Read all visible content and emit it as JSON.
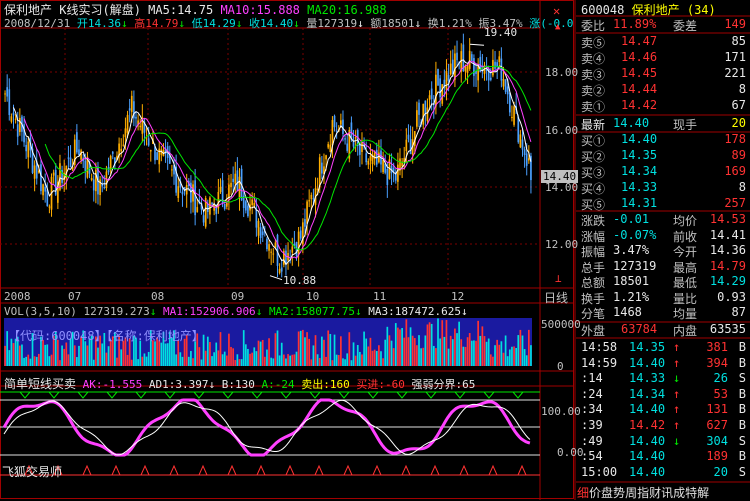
{
  "chart": {
    "title": "保利地产",
    "mode": "K线实习(解盘)",
    "ma5": "MA5:14.75",
    "ma10": "MA10:15.888",
    "ma20": "MA20:16.988",
    "info_line": {
      "date": "2008/12/31",
      "open": "开14.36",
      "high": "高14.79",
      "low": "低14.29",
      "close": "收14.40",
      "volume": "量127319",
      "amount": "额18501",
      "turnover": "换1.21%",
      "amplitude": "振3.47%",
      "change": "涨(-0.0"
    },
    "price_axis": [
      "18.00",
      "16.00",
      "14.00",
      "12.00"
    ],
    "high_label": "19.40",
    "low_label": "10.88",
    "last_price": "14.40",
    "x_months": [
      "2008",
      "07",
      "08",
      "09",
      "10",
      "11",
      "12"
    ],
    "period": "日线",
    "vol_line": {
      "title": "VOL(3,5,10)",
      "value": "127319.273",
      "ma1": "MA1:152906.906",
      "ma2": "MA2:158077.75",
      "ma3": "MA3:187472.625"
    },
    "vol_overlay": "【代码:600048】【名称:保利地产】",
    "vol_axis": [
      "500000",
      "0"
    ],
    "ind_line": {
      "title": "简单短线买卖",
      "ak": "AK:-1.555",
      "ad1": "AD1:3.397",
      "b": "B:130",
      "a": "A:-24",
      "sell": "卖出:160",
      "buy": "买进:-60",
      "strong": "强弱分界:65"
    },
    "ind_axis": [
      "100.00",
      "0.00"
    ],
    "watermark": "飞狐交易师"
  },
  "chart_data": {
    "type": "candlestick",
    "x": [
      "2008",
      "07",
      "08",
      "09",
      "10",
      "11",
      "12"
    ],
    "ylim": [
      10.5,
      20.0
    ],
    "y_ticks": [
      12.0,
      14.0,
      16.0,
      18.0
    ],
    "high": 19.4,
    "low": 10.88,
    "last": 14.4,
    "series": [
      {
        "name": "MA5",
        "last": 14.75
      },
      {
        "name": "MA10",
        "last": 15.888
      },
      {
        "name": "MA20",
        "last": 16.988
      }
    ],
    "volume": {
      "ylim": [
        0,
        500000
      ],
      "last": 127319.273,
      "MA1": 152906.906,
      "MA2": 158077.75,
      "MA3": 187472.625
    },
    "indicator": {
      "ylim": [
        0,
        100
      ],
      "AK": -1.555,
      "AD1": 3.397,
      "B": 130,
      "A": -24
    }
  },
  "quote": {
    "code": "600048",
    "name": "保利地产",
    "count": "(34)",
    "weibi_label": "委比",
    "weibi_value": "11.89%",
    "weicha_label": "委差",
    "weicha_value": "149",
    "sells": [
      {
        "label": "卖⑤",
        "price": "14.47",
        "vol": "85"
      },
      {
        "label": "卖④",
        "price": "14.46",
        "vol": "171"
      },
      {
        "label": "卖③",
        "price": "14.45",
        "vol": "221"
      },
      {
        "label": "卖②",
        "price": "14.44",
        "vol": "8"
      },
      {
        "label": "卖①",
        "price": "14.42",
        "vol": "67"
      }
    ],
    "latest_label": "最新",
    "latest_value": "14.40",
    "xianshou_label": "现手",
    "xianshou_value": "20",
    "buys": [
      {
        "label": "买①",
        "price": "14.40",
        "vol": "178"
      },
      {
        "label": "买②",
        "price": "14.35",
        "vol": "89"
      },
      {
        "label": "买③",
        "price": "14.34",
        "vol": "169"
      },
      {
        "label": "买④",
        "price": "14.33",
        "vol": "8"
      },
      {
        "label": "买⑤",
        "price": "14.31",
        "vol": "257"
      }
    ],
    "stats": [
      {
        "l1": "涨跌",
        "v1": "-0.01",
        "l2": "均价",
        "v2": "14.53"
      },
      {
        "l1": "涨幅",
        "v1": "-0.07%",
        "l2": "前收",
        "v2": "14.41"
      },
      {
        "l1": "振幅",
        "v1": "3.47%",
        "l2": "今开",
        "v2": "14.36"
      },
      {
        "l1": "总手",
        "v1": "127319",
        "l2": "最高",
        "v2": "14.79"
      },
      {
        "l1": "总额",
        "v1": "18501",
        "l2": "最低",
        "v2": "14.29"
      },
      {
        "l1": "换手",
        "v1": "1.21%",
        "l2": "量比",
        "v2": "0.93"
      },
      {
        "l1": "分笔",
        "v1": "1468",
        "l2": "均量",
        "v2": "87"
      }
    ],
    "waipan_label": "外盘",
    "waipan_value": "63784",
    "neipan_label": "内盘",
    "neipan_value": "63535",
    "ticks": [
      {
        "time": "14:58",
        "price": "14.35",
        "arrow": "↑",
        "vol": "381",
        "bs": "B"
      },
      {
        "time": "14:59",
        "price": "14.40",
        "arrow": "↑",
        "vol": "394",
        "bs": "B"
      },
      {
        "time": ":14",
        "price": "14.33",
        "arrow": "↓",
        "vol": "26",
        "bs": "S"
      },
      {
        "time": ":24",
        "price": "14.34",
        "arrow": "↑",
        "vol": "53",
        "bs": "B"
      },
      {
        "time": ":34",
        "price": "14.40",
        "arrow": "↑",
        "vol": "131",
        "bs": "B"
      },
      {
        "time": ":39",
        "price": "14.42",
        "arrow": "↑",
        "vol": "627",
        "bs": "B"
      },
      {
        "time": ":49",
        "price": "14.40",
        "arrow": "↓",
        "vol": "304",
        "bs": "S"
      },
      {
        "time": ":54",
        "price": "14.40",
        "arrow": "",
        "vol": "189",
        "bs": "B"
      },
      {
        "time": "15:00",
        "price": "14.40",
        "arrow": "",
        "vol": "20",
        "bs": "S"
      }
    ],
    "bottom_tabs": [
      "细",
      "价",
      "盘",
      "势",
      "周",
      "指",
      "财",
      "讯",
      "成",
      "特",
      "解"
    ]
  }
}
